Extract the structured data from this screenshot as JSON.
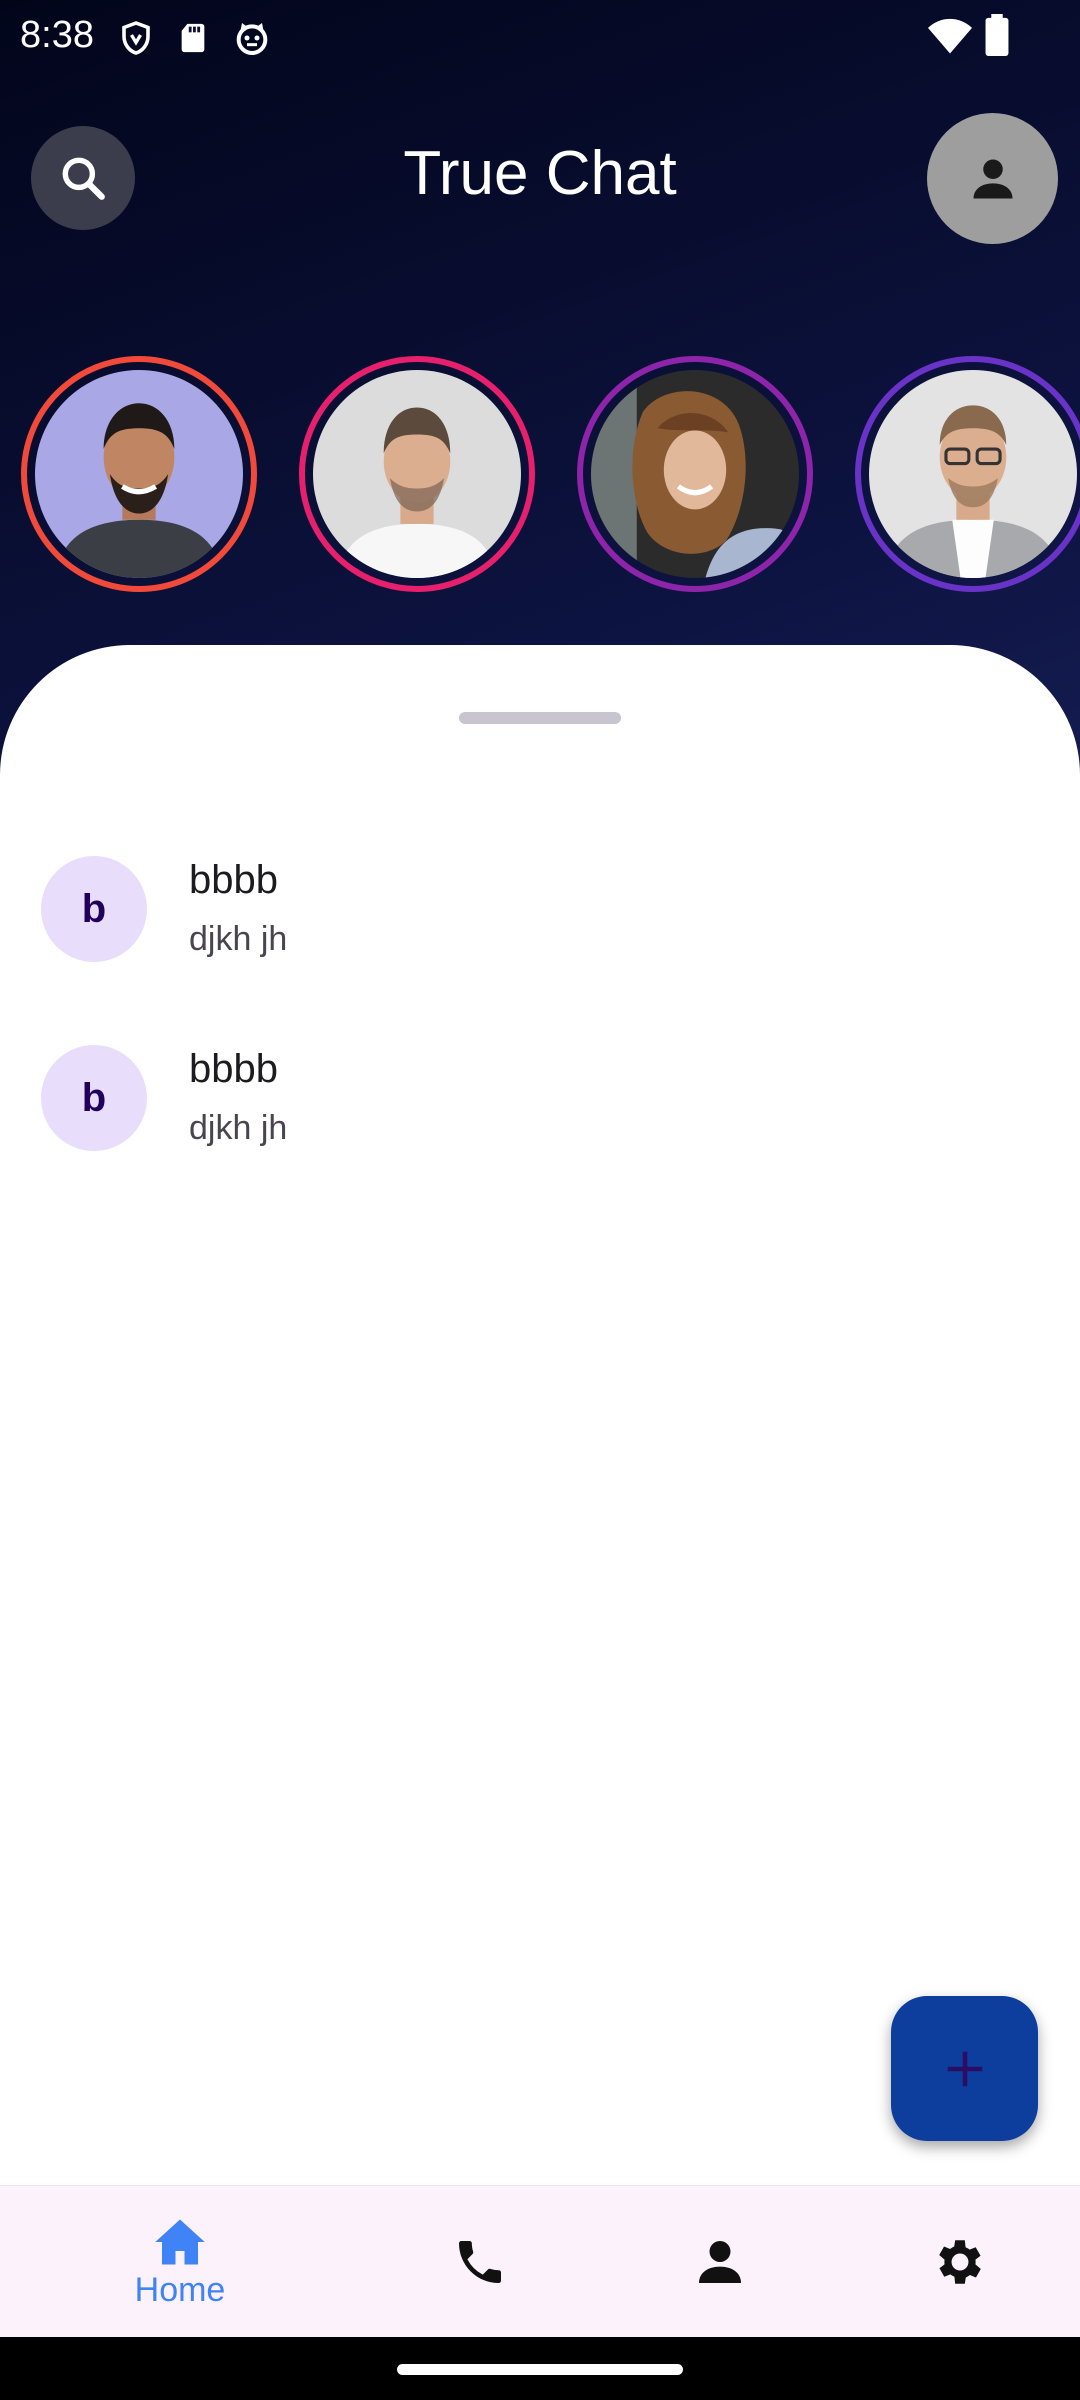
{
  "status_bar": {
    "time": "8:38",
    "icons": [
      "shield-icon",
      "sd-card-icon",
      "cat-face-icon",
      "wifi-icon",
      "battery-icon"
    ]
  },
  "header": {
    "title": "True Chat",
    "search_icon": "search-icon",
    "profile_icon": "person-icon"
  },
  "stories": [
    {
      "ring_color": "#f14a3a"
    },
    {
      "ring_color": "#e6206c"
    },
    {
      "ring_color": "#8e24aa"
    },
    {
      "ring_color": "#6a33c8"
    }
  ],
  "chats": [
    {
      "initial": "b",
      "name": "bbbb",
      "message": "djkh jh"
    },
    {
      "initial": "b",
      "name": "bbbb",
      "message": "djkh jh"
    }
  ],
  "fab": {
    "icon": "plus-icon",
    "color": "#0d3e9e"
  },
  "nav": {
    "items": [
      {
        "icon": "home-icon",
        "label": "Home",
        "active": true
      },
      {
        "icon": "phone-icon",
        "label": "",
        "active": false
      },
      {
        "icon": "person-icon",
        "label": "",
        "active": false
      },
      {
        "icon": "gear-icon",
        "label": "",
        "active": false
      }
    ],
    "active_color": "#3f83f7"
  }
}
